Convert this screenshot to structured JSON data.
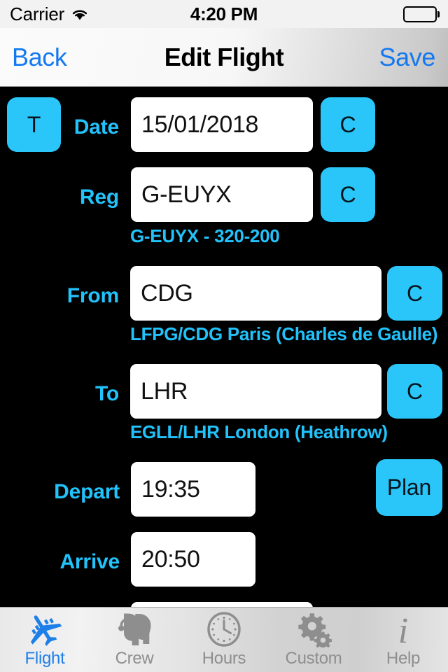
{
  "status_bar": {
    "carrier": "Carrier",
    "wifi_icon": "wifi-icon",
    "time": "4:20 PM",
    "battery_icon": "battery-full-icon"
  },
  "nav_bar": {
    "back_label": "Back",
    "title": "Edit Flight",
    "save_label": "Save"
  },
  "form": {
    "total_button_label": "T",
    "rows": [
      {
        "label": "Date",
        "value": "15/01/2018",
        "button_label": "C",
        "note": ""
      },
      {
        "label": "Reg",
        "value": "G-EUYX",
        "button_label": "C",
        "note": "G-EUYX - 320-200"
      },
      {
        "label": "From",
        "value": "CDG",
        "button_label": "C",
        "note": "LFPG/CDG Paris (Charles de Gaulle)"
      },
      {
        "label": "To",
        "value": "LHR",
        "button_label": "C",
        "note": "EGLL/LHR London (Heathrow)"
      },
      {
        "label": "Depart",
        "value": "19:35",
        "button_label": "Plan",
        "note": ""
      },
      {
        "label": "Arrive",
        "value": "20:50",
        "button_label": "",
        "note": ""
      }
    ]
  },
  "tab_bar": {
    "tabs": [
      {
        "label": "Flight",
        "icon": "airplane-icon",
        "active": true
      },
      {
        "label": "Crew",
        "icon": "crew-headset-icon",
        "active": false
      },
      {
        "label": "Hours",
        "icon": "clock-icon",
        "active": false
      },
      {
        "label": "Custom",
        "icon": "gears-icon",
        "active": false
      },
      {
        "label": "Help",
        "icon": "info-i-icon",
        "active": false
      }
    ]
  },
  "colors": {
    "accent_cyan": "#2ac6fa",
    "label_cyan": "#22c2fa",
    "nav_link_blue": "#1479f0",
    "tab_active_blue": "#1e7fe8",
    "tab_inactive_gray": "#8e8e8e",
    "background": "#000000"
  }
}
